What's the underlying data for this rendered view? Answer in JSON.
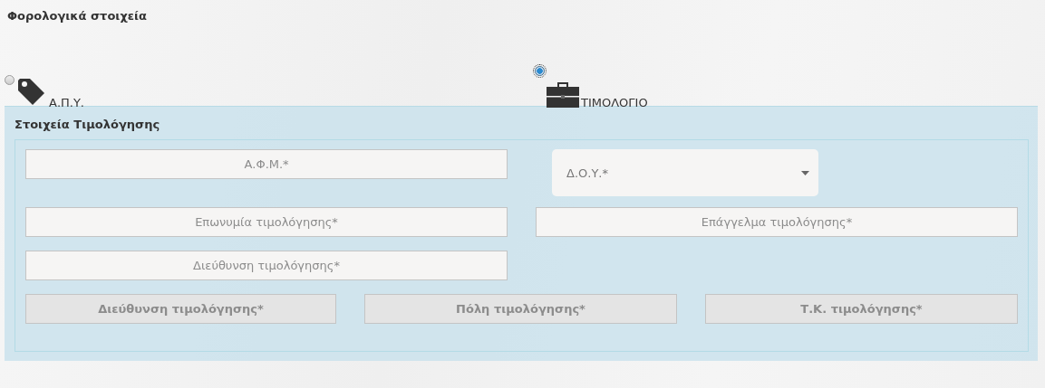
{
  "heading": "Φορολογικά στοιχεία",
  "options": [
    {
      "label": "Α.Π.Υ.",
      "selected": false,
      "kind": "tag"
    },
    {
      "label": "ΤΙΜΟΛΟΓΙΟ",
      "selected": true,
      "kind": "briefcase"
    }
  ],
  "panel": {
    "title": "Στοιχεία Τιμολόγησης",
    "rows": [
      {
        "fields": [
          {
            "kind": "input",
            "placeholder": "Α.Φ.Μ.*",
            "disabled": false
          },
          {
            "kind": "select",
            "placeholder": "Δ.Ο.Υ.*",
            "disabled": false
          }
        ]
      },
      {
        "fields": [
          {
            "kind": "input",
            "placeholder": "Επωνυμία τιμολόγησης*",
            "disabled": false
          },
          {
            "kind": "input",
            "placeholder": "Επάγγελμα τιμολόγησης*",
            "disabled": false
          }
        ]
      },
      {
        "fields": [
          {
            "kind": "input",
            "placeholder": "Διεύθυνση τιμολόγησης*",
            "disabled": false
          }
        ]
      },
      {
        "fields": [
          {
            "kind": "input",
            "placeholder": "Διεύθυνση τιμολόγησης*",
            "disabled": true
          },
          {
            "kind": "input",
            "placeholder": "Πόλη τιμολόγησης*",
            "disabled": true
          },
          {
            "kind": "input",
            "placeholder": "Τ.Κ. τιμολόγησης*",
            "disabled": true
          }
        ]
      }
    ]
  }
}
